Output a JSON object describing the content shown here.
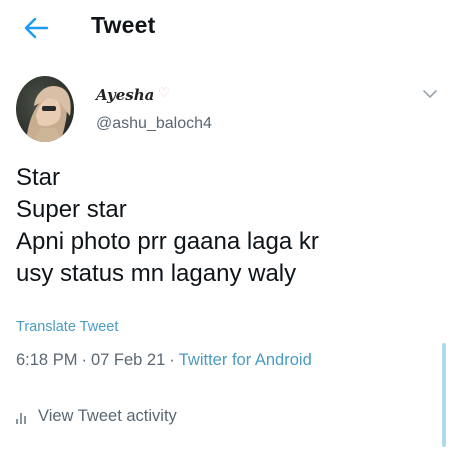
{
  "header": {
    "title": "Tweet",
    "back_icon": "arrow-left-icon",
    "accent": "#1d9bf0"
  },
  "author": {
    "display_name": "Ayesha",
    "name_decoration": "♡",
    "username": "@ashu_baloch4",
    "avatar_icon": "avatar",
    "menu_icon": "chevron-down-icon"
  },
  "tweet": {
    "lines": [
      "Star",
      "Super star",
      "Apni photo prr gaana laga kr",
      "usy status mn lagany waly"
    ]
  },
  "translate_label": "Translate Tweet",
  "meta": {
    "time": "6:18 PM",
    "separator": "·",
    "date": "07 Feb 21",
    "source": "Twitter for Android"
  },
  "activity": {
    "label": "View Tweet activity",
    "icon": "bar-chart-icon"
  },
  "colors": {
    "link": "#4a9cc2",
    "secondary_text": "#5b6873",
    "scrollbar": "#a9dced"
  }
}
